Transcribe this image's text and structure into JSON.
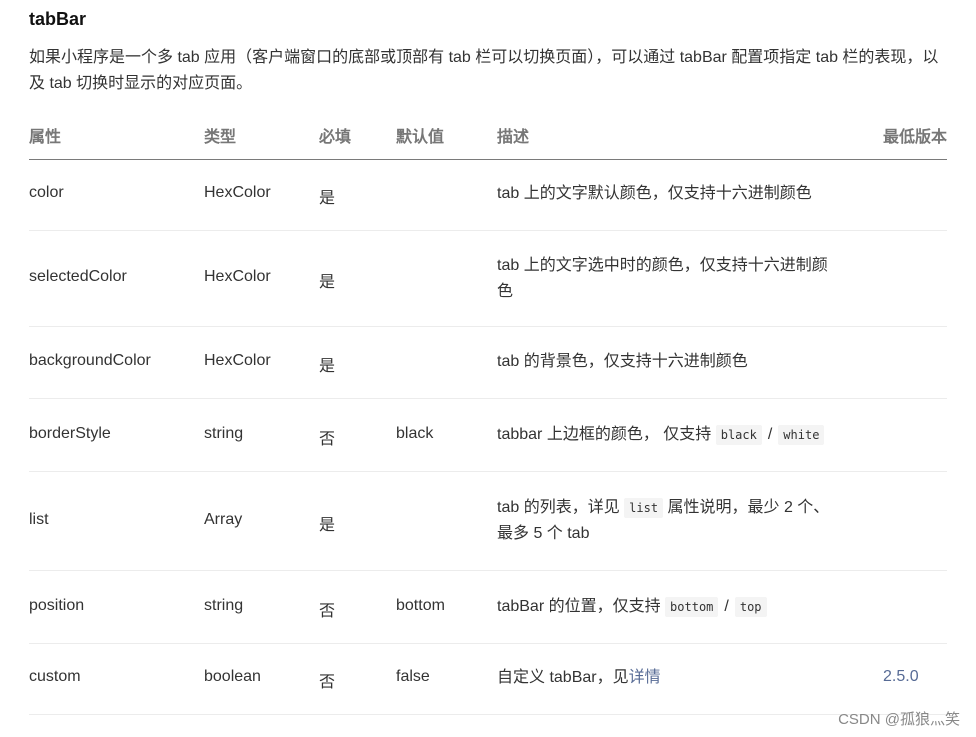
{
  "title": "tabBar",
  "intro": {
    "line1": "如果小程序是一个多 tab 应用（客户端窗口的底部或顶部有 tab 栏可以切换页面），可以通过 tabBar 配置项指定 tab 栏的表现，以",
    "line2": "及 tab 切换时显示的对应页面。"
  },
  "table": {
    "headers": {
      "attr": "属性",
      "type": "类型",
      "required": "必填",
      "default": "默认值",
      "desc": "描述",
      "version": "最低版本"
    },
    "rows": [
      {
        "attr": "color",
        "type": "HexColor",
        "required": "是",
        "default": "",
        "desc": "tab 上的文字默认颜色，仅支持十六进制颜色",
        "version": ""
      },
      {
        "attr": "selectedColor",
        "type": "HexColor",
        "required": "是",
        "default": "",
        "desc_line1": "tab 上的文字选中时的颜色，仅支持十六进制颜",
        "desc_line2": "色",
        "version": ""
      },
      {
        "attr": "backgroundColor",
        "type": "HexColor",
        "required": "是",
        "default": "",
        "desc": "tab 的背景色，仅支持十六进制颜色",
        "version": ""
      },
      {
        "attr": "borderStyle",
        "type": "string",
        "required": "否",
        "default": "black",
        "desc_pre": "tabbar 上边框的颜色， 仅支持",
        "code1": "black",
        "sep": "/",
        "code2": "white",
        "version": ""
      },
      {
        "attr": "list",
        "type": "Array",
        "required": "是",
        "default": "",
        "desc_pre": "tab 的列表，详见",
        "code": "list",
        "desc_post": "属性说明，最少 2 个、",
        "desc_line2": "最多 5 个 tab",
        "version": ""
      },
      {
        "attr": "position",
        "type": "string",
        "required": "否",
        "default": "bottom",
        "desc_pre": "tabBar 的位置，仅支持",
        "code1": "bottom",
        "sep": "/",
        "code2": "top",
        "version": ""
      },
      {
        "attr": "custom",
        "type": "boolean",
        "required": "否",
        "default": "false",
        "desc_pre": "自定义 tabBar，见",
        "link": "详情",
        "version": "2.5.0"
      }
    ]
  },
  "watermark": "CSDN @孤狼灬笑",
  "colors": {
    "link": "#576b95",
    "header_text": "#777777",
    "header_rule": "#7a7a7a",
    "row_rule": "#ececec",
    "code_bg": "#f4f4f4"
  }
}
